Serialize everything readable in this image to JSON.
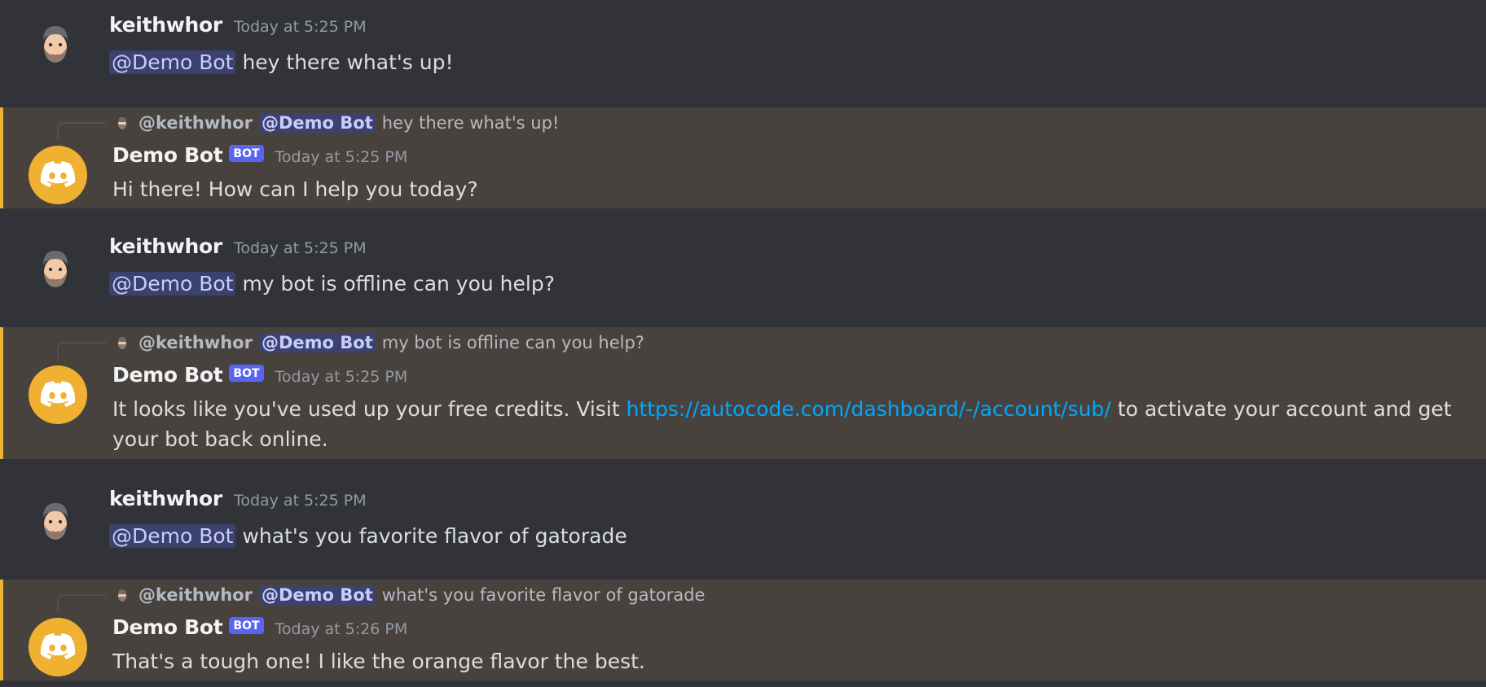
{
  "messages": [
    {
      "author": "keithwhor",
      "timestamp": "Today at 5:25 PM",
      "mention": "@Demo Bot",
      "text": "hey there what's up!"
    },
    {
      "reply_user": "@keithwhor",
      "reply_mention": "@Demo Bot",
      "reply_text": "hey there what's up!",
      "author": "Demo Bot",
      "bot_tag": "BOT",
      "timestamp": "Today at 5:25 PM",
      "text": "Hi there! How can I help you today?"
    },
    {
      "author": "keithwhor",
      "timestamp": "Today at 5:25 PM",
      "mention": "@Demo Bot",
      "text": "my bot is offline can you help?"
    },
    {
      "reply_user": "@keithwhor",
      "reply_mention": "@Demo Bot",
      "reply_text": "my bot is offline can you help?",
      "author": "Demo Bot",
      "bot_tag": "BOT",
      "timestamp": "Today at 5:25 PM",
      "text_before": "It looks like you've used up your free credits. Visit",
      "link": "https://autocode.com/dashboard/-/account/sub/",
      "text_after": "to activate your account and get your bot back online."
    },
    {
      "author": "keithwhor",
      "timestamp": "Today at 5:25 PM",
      "mention": "@Demo Bot",
      "text": "what's you favorite flavor of gatorade"
    },
    {
      "reply_user": "@keithwhor",
      "reply_mention": "@Demo Bot",
      "reply_text": "what's you favorite flavor of gatorade",
      "author": "Demo Bot",
      "bot_tag": "BOT",
      "timestamp": "Today at 5:26 PM",
      "text": "That's a tough one! I like the orange flavor the best."
    }
  ],
  "colors": {
    "background": "#313338",
    "highlight_background": "#48423e",
    "highlight_border": "#f0b232",
    "bot_avatar": "#f0b132",
    "bot_tag": "#5865f2",
    "mention_background": "#3c4270",
    "mention_text": "#c9cdfb",
    "link": "#00a8fc"
  },
  "icons": {
    "user_avatar": "bearded-man-avatar-icon",
    "bot_avatar": "discord-logo-icon"
  }
}
